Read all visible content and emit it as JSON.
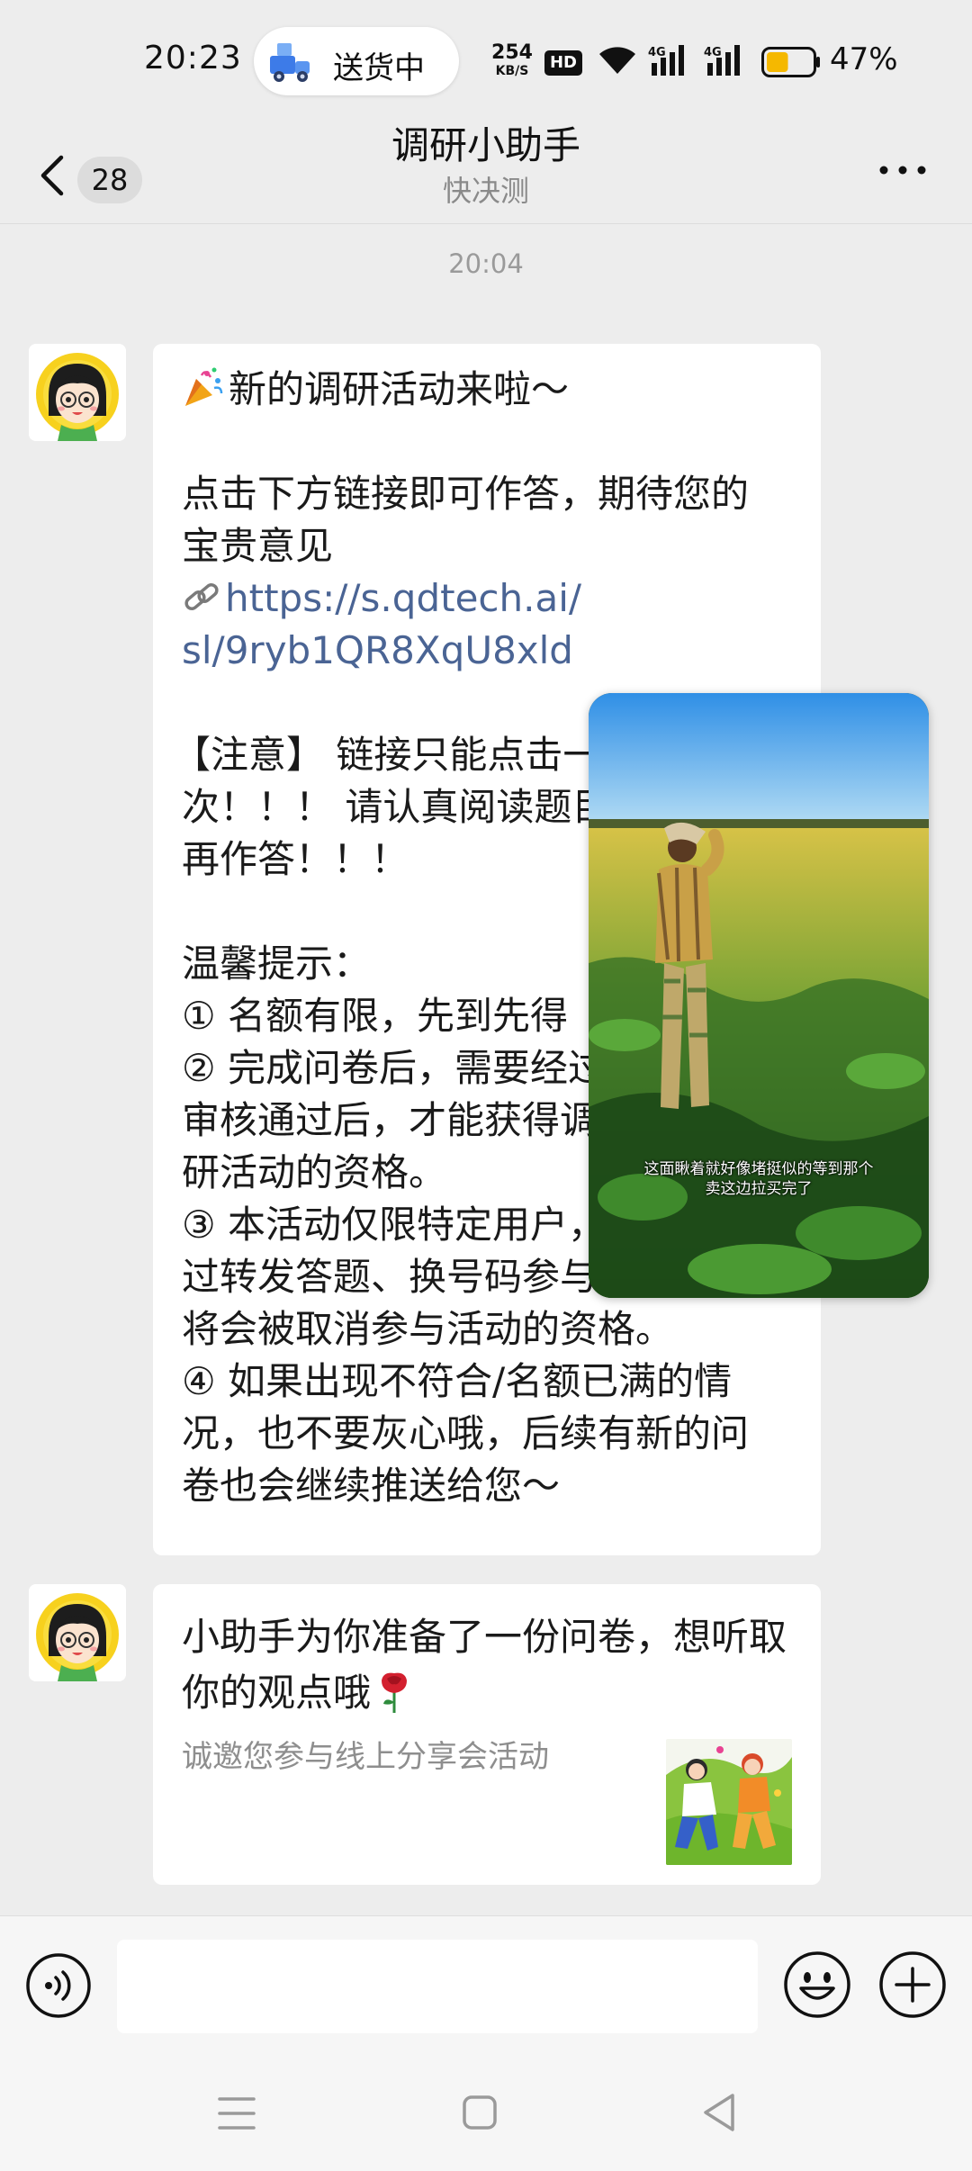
{
  "status_bar": {
    "time": "20:23",
    "live_activity_label": "送货中",
    "network_speed_value": "254",
    "network_speed_unit": "KB/S",
    "hd_label": "HD",
    "signal_1_label": "4G",
    "signal_2_label": "4G",
    "battery_percent": "47%",
    "battery_level": 0.47
  },
  "header": {
    "unread_count": "28",
    "title": "调研小助手",
    "subtitle": "快决测"
  },
  "chat": {
    "timestamp": "20:04",
    "message_1": {
      "lines": [
        "新的调研活动来啦～",
        "",
        "点击下方链接即可作答，期待您的",
        "宝贵意见",
        "https://s.qdtech.ai/",
        "sl/9ryb1QR8XqU8xld",
        "",
        "【注意】 链接只能点击一",
        "次！！！ 请认真阅读题目",
        "再作答！！！",
        "",
        "温馨提示：",
        "① 名额有限，先到先得",
        "② 完成问卷后，需要经过",
        "审核通过后，才能获得调",
        "研活动的资格。",
        "③ 本活动仅限特定用户，",
        "过转发答题、换号码参与等行为，",
        "将会被取消参与活动的资格。",
        "④ 如果出现不符合/名额已满的情",
        "况，也不要灰心哦，后续有新的问",
        "卷也会继续推送给您～"
      ]
    },
    "message_2": {
      "title": "小助手为你准备了一份问卷，想听取你的观点哦",
      "description": "诚邀您参与线上分享会活动"
    }
  },
  "floating_video": {
    "caption": "这面瞅着就好像堵挺似的等到那个\n卖这边拉买完了"
  },
  "colors": {
    "background": "#ededed",
    "bubble": "#ffffff",
    "link": "#4a6494",
    "battery_fill": "#f5b800"
  },
  "icons": {
    "back": "chevron-left-icon",
    "more": "more-dots-icon",
    "voice": "voice-input-icon",
    "emoji": "emoji-smile-icon",
    "plus": "plus-circle-icon",
    "nav_menu": "nav-menu-icon",
    "nav_home": "nav-home-icon",
    "nav_back": "nav-back-icon"
  }
}
